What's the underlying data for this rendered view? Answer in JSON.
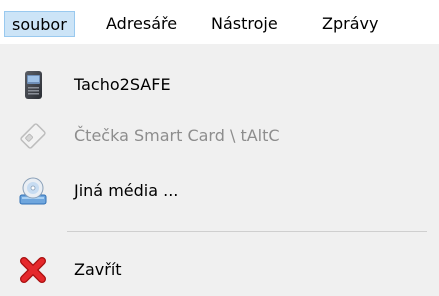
{
  "menubar": {
    "items": [
      {
        "label": "soubor"
      },
      {
        "label": "Adresáře"
      },
      {
        "label": "Nástroje"
      },
      {
        "label": "Zprávy"
      }
    ]
  },
  "dropdown": {
    "items": [
      {
        "label": "Tacho2SAFE",
        "icon": "card-reader-device-icon"
      },
      {
        "label": "Čtečka Smart Card \\ tAltC",
        "icon": "smart-card-icon",
        "enabled": false
      },
      {
        "label": "Jiná média ...",
        "icon": "disc-drive-icon"
      },
      {
        "label": "Zavřít",
        "icon": "red-x-close-icon"
      }
    ]
  }
}
